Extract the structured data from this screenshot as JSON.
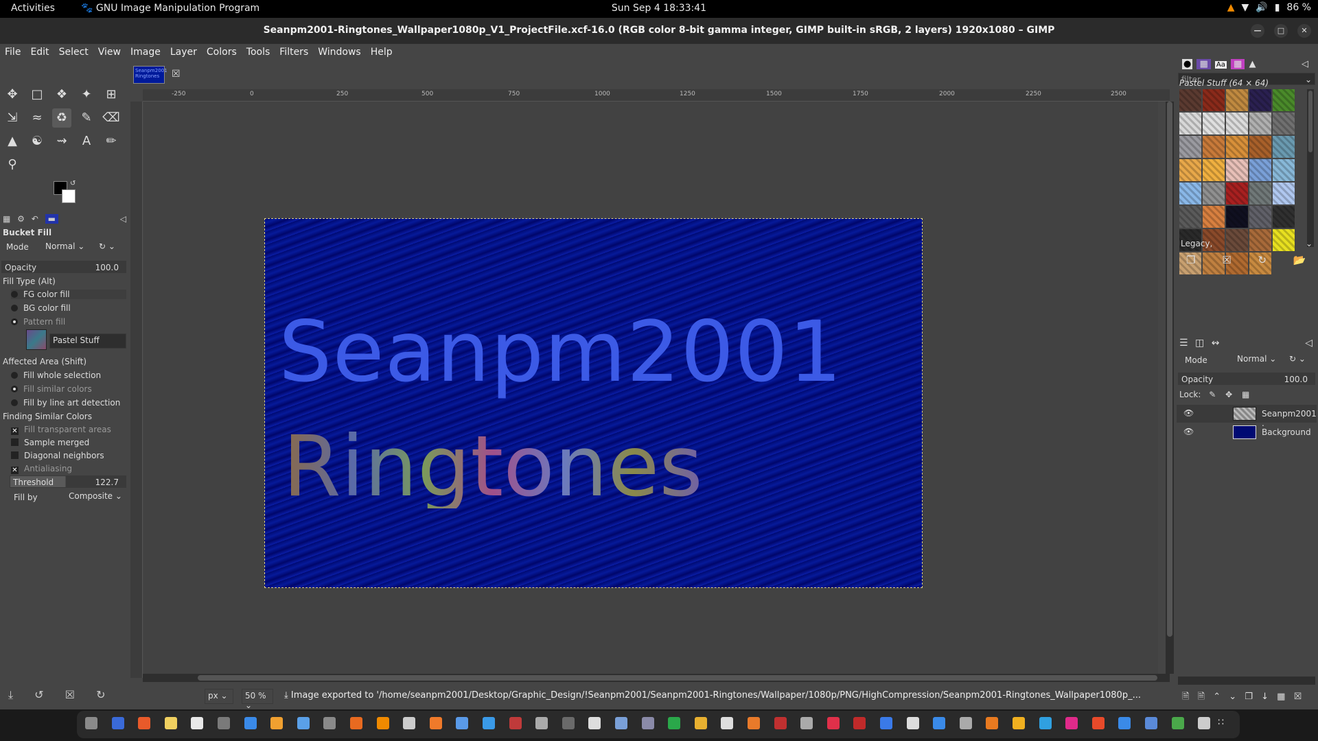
{
  "topbar": {
    "activities": "Activities",
    "app_name": "GNU Image Manipulation Program",
    "clock": "Sun Sep 4  18:33:41",
    "battery": "86 %"
  },
  "window": {
    "title": "Seanpm2001-Ringtones_Wallpaper1080p_V1_ProjectFile.xcf-16.0 (RGB color 8-bit gamma integer, GIMP built-in sRGB, 2 layers) 1920x1080 – GIMP"
  },
  "menu": [
    "File",
    "Edit",
    "Select",
    "View",
    "Image",
    "Layer",
    "Colors",
    "Tools",
    "Filters",
    "Windows",
    "Help"
  ],
  "tool_options": {
    "title": "Bucket Fill",
    "mode_label": "Mode",
    "mode_value": "Normal",
    "opacity_label": "Opacity",
    "opacity_value": "100.0",
    "fill_type_label": "Fill Type  (Alt)",
    "fill_types": [
      "FG color fill",
      "BG color fill",
      "Pattern fill"
    ],
    "pattern_name": "Pastel Stuff",
    "affected_area_label": "Affected Area  (Shift)",
    "affected_areas": [
      "Fill whole selection",
      "Fill similar colors",
      "Fill by line art detection"
    ],
    "finding_label": "Finding Similar Colors",
    "finding_options": [
      "Fill transparent areas",
      "Sample merged",
      "Diagonal neighbors",
      "Antialiasing"
    ],
    "threshold_label": "Threshold",
    "threshold_value": "122.7",
    "fill_by_label": "Fill by",
    "fill_by_value": "Composite"
  },
  "image_tab": {
    "thumb_text": "Seanpm2001 Ringtones"
  },
  "ruler": [
    "-250",
    "0",
    "250",
    "500",
    "750",
    "1000",
    "1250",
    "1500",
    "1750",
    "2000",
    "2250",
    "2500"
  ],
  "canvas_image": {
    "line1": "Seanpm2001",
    "line2": "Ringtones"
  },
  "status": {
    "unit": "px",
    "zoom": "50 %",
    "message": "Image exported to '/home/seanpm2001/Desktop/Graphic_Design/!Seanpm2001/Seanpm2001-Ringtones/Wallpaper/1080p/PNG/HighCompression/Seanpm2001-Ringtones_Wallpaper1080p_..."
  },
  "patterns_panel": {
    "filter_placeholder": "filter",
    "title": "Pastel Stuff (64 × 64)",
    "tag": "Legacy,",
    "swatch_colors": [
      "#5a3a30",
      "#8a2a1a",
      "#c08a40",
      "#2a2050",
      "#4a8a2a",
      "#d8d8d8",
      "#e0e0e0",
      "#dcdcdc",
      "#b0b0b0",
      "#707070",
      "#9a9aa0",
      "#c87a3a",
      "#d8903a",
      "#a8602a",
      "#6a9ab0",
      "#e8a84a",
      "#f0b040",
      "#e8c0b8",
      "#7aa0d8",
      "#88b8d8",
      "#8ab8e8",
      "#909090",
      "#a82020",
      "#707878",
      "#b0c8f0",
      "#5a5a5a",
      "#d88040",
      "#101020",
      "#606068",
      "#303030",
      "#2a2a2a",
      "#8a4a2a",
      "#6a4a3a",
      "#a86a3a",
      "#e8e020",
      "#c8a070",
      "#c08040",
      "#b06a30",
      "#c88a40"
    ]
  },
  "layers_panel": {
    "mode_label": "Mode",
    "mode_value": "Normal",
    "opacity_label": "Opacity",
    "opacity_value": "100.0",
    "lock_label": "Lock:",
    "layers": [
      {
        "name": "Seanpm2001 .",
        "visible": true
      },
      {
        "name": "Background",
        "visible": true
      }
    ]
  },
  "colors": {
    "fg": "#000000",
    "bg": "#ffffff",
    "image_blue": "#000a72",
    "text_blue": "#3c5ae6"
  }
}
